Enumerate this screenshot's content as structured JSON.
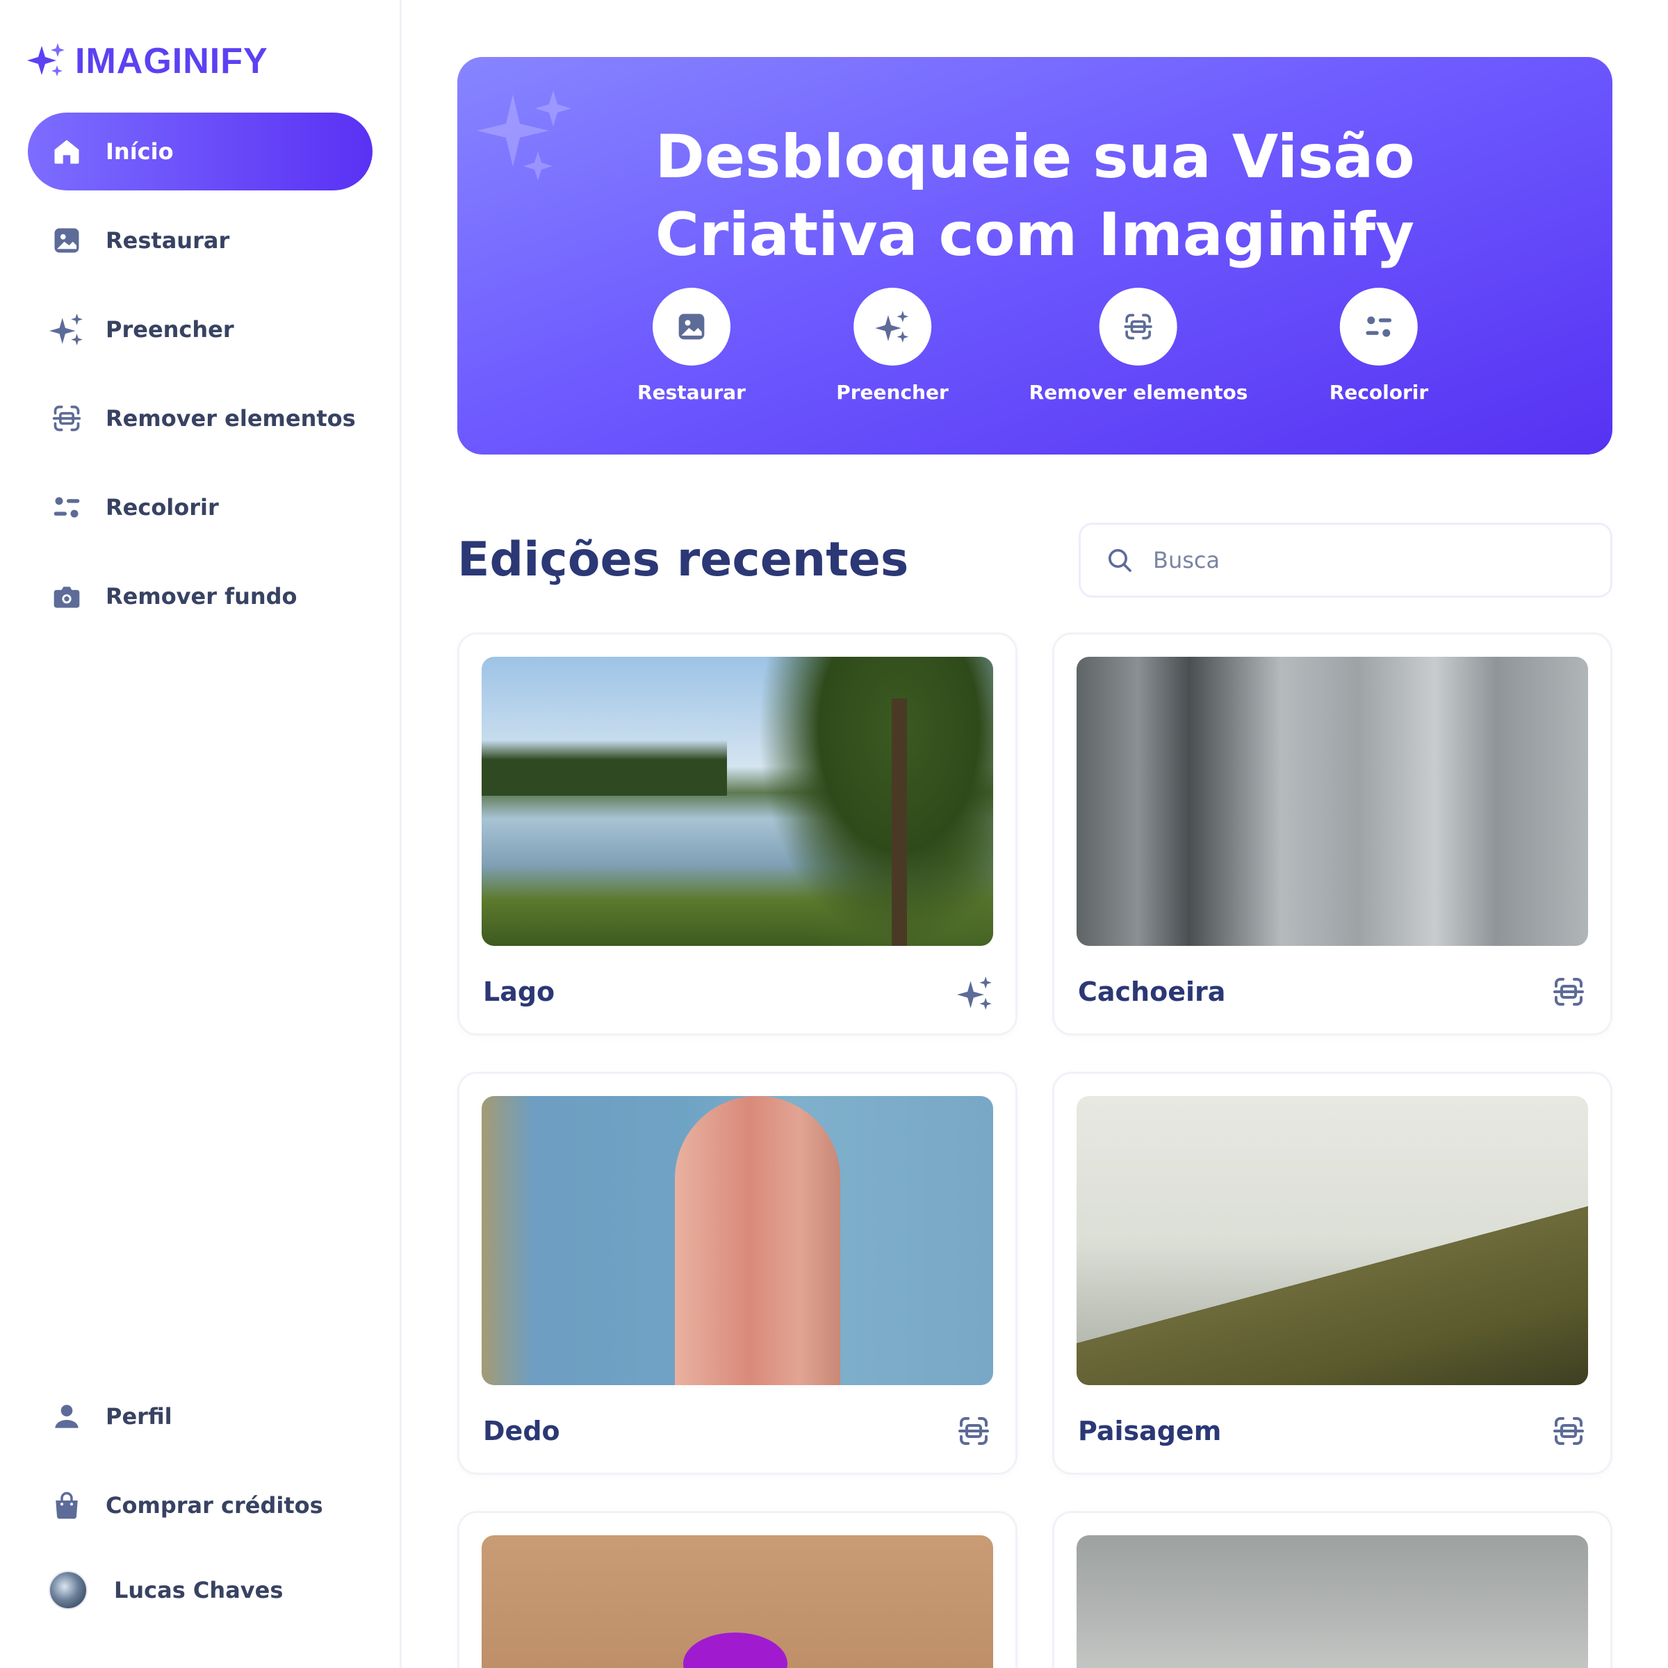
{
  "app": {
    "name": "IMAGINIFY",
    "brand_color": "#5b41f2"
  },
  "sidebar": {
    "items": [
      {
        "label": "Início",
        "icon": "home-icon",
        "active": true
      },
      {
        "label": "Restaurar",
        "icon": "image-icon",
        "active": false
      },
      {
        "label": "Preencher",
        "icon": "stars-icon",
        "active": false
      },
      {
        "label": "Remover elementos",
        "icon": "scan-icon",
        "active": false
      },
      {
        "label": "Recolorir",
        "icon": "filter-icon",
        "active": false
      },
      {
        "label": "Remover fundo",
        "icon": "camera-icon",
        "active": false
      }
    ],
    "bottom_items": [
      {
        "label": "Perfil",
        "icon": "user-icon"
      },
      {
        "label": "Comprar créditos",
        "icon": "bag-icon"
      }
    ],
    "user": {
      "name": "Lucas Chaves"
    }
  },
  "hero": {
    "title_line1": "Desbloqueie sua Visão",
    "title_line2": "Criativa com Imaginify",
    "tools": [
      {
        "label": "Restaurar",
        "icon": "image-icon"
      },
      {
        "label": "Preencher",
        "icon": "stars-icon"
      },
      {
        "label": "Remover elementos",
        "icon": "scan-icon"
      },
      {
        "label": "Recolorir",
        "icon": "filter-icon"
      }
    ]
  },
  "recent": {
    "title": "Edições recentes",
    "search_placeholder": "Busca",
    "items": [
      {
        "title": "Lago",
        "type_icon": "stars-icon"
      },
      {
        "title": "Cachoeira",
        "type_icon": "scan-icon"
      },
      {
        "title": "Dedo",
        "type_icon": "scan-icon"
      },
      {
        "title": "Paisagem",
        "type_icon": "scan-icon"
      }
    ]
  }
}
